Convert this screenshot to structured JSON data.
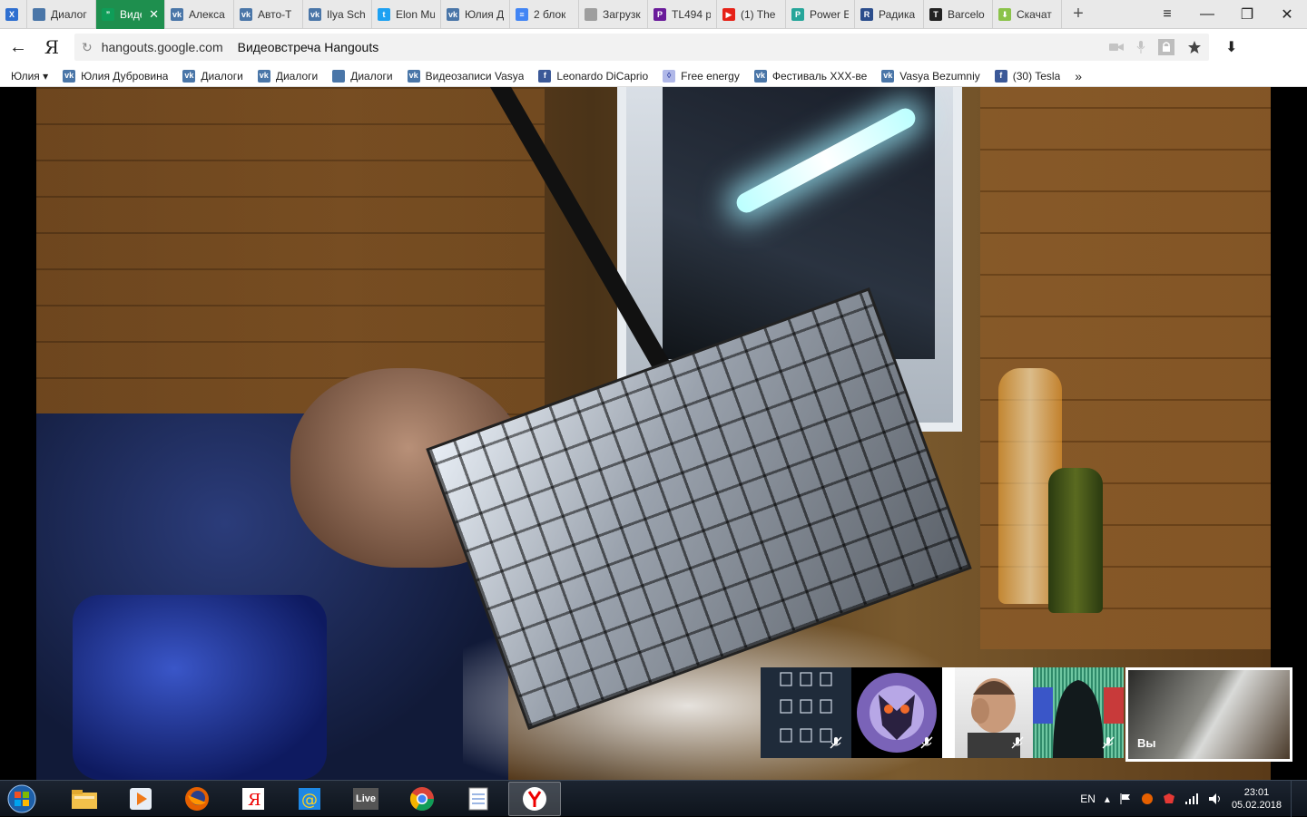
{
  "browser": {
    "tabs": [
      {
        "label": "",
        "icon": "yandex-x-icon",
        "color": "#2e6fd0",
        "glyph": "X",
        "width": 30
      },
      {
        "label": "Диалог",
        "icon": "chat-bubble-icon",
        "color": "#4a76a8",
        "glyph": "",
        "width": 76
      },
      {
        "label": "Виде",
        "icon": "hangouts-icon",
        "color": "#0f9d58",
        "glyph": "”",
        "width": 76,
        "active": true
      },
      {
        "label": "Алекса",
        "icon": "vk-icon",
        "color": "#4a76a8",
        "glyph": "vk",
        "width": 76
      },
      {
        "label": "Авто-Т",
        "icon": "vk-icon",
        "color": "#4a76a8",
        "glyph": "vk",
        "width": 76
      },
      {
        "label": "Ilya Sch",
        "icon": "vk-icon",
        "color": "#4a76a8",
        "glyph": "vk",
        "width": 76
      },
      {
        "label": "Elon Mu",
        "icon": "twitter-icon",
        "color": "#1da1f2",
        "glyph": "t",
        "width": 76
      },
      {
        "label": "Юлия Д",
        "icon": "vk-icon",
        "color": "#4a76a8",
        "glyph": "vk",
        "width": 76
      },
      {
        "label": "2 блок",
        "icon": "docs-icon",
        "color": "#4285f4",
        "glyph": "≡",
        "width": 76
      },
      {
        "label": "Загрузк",
        "icon": "page-icon",
        "color": "#9e9e9e",
        "glyph": "",
        "width": 76
      },
      {
        "label": "TL494 р",
        "icon": "pdf-icon",
        "color": "#6a1b9a",
        "glyph": "P",
        "width": 76
      },
      {
        "label": "(1) The",
        "icon": "youtube-icon",
        "color": "#e62117",
        "glyph": "▶",
        "width": 76
      },
      {
        "label": "Power E",
        "icon": "power-icon",
        "color": "#26a69a",
        "glyph": "P",
        "width": 76
      },
      {
        "label": "Радика",
        "icon": "radiokot-icon",
        "color": "#2b4d8c",
        "glyph": "R",
        "width": 76
      },
      {
        "label": "Barcelo",
        "icon": "t-logo-icon",
        "color": "#222222",
        "glyph": "T",
        "width": 76
      },
      {
        "label": "Скачат",
        "icon": "download-arrow-icon",
        "color": "#8bc34a",
        "glyph": "⬇",
        "width": 76
      }
    ],
    "new_tab": "+",
    "window": {
      "menu": "≡",
      "minimize": "—",
      "restore": "❐",
      "close": "✕"
    },
    "address": {
      "back": "←",
      "yandex": "Я",
      "reload": "↻",
      "domain": "hangouts.google.com",
      "title": "Видеовстреча Hangouts",
      "download": "⬇"
    },
    "bookmarks": [
      {
        "label": "Юлия ▾",
        "icon": "",
        "kind": "folder"
      },
      {
        "label": "Юлия Дубровина",
        "icon": "vk-icon",
        "kind": "vk"
      },
      {
        "label": "Диалоги",
        "icon": "vk-icon",
        "kind": "vk"
      },
      {
        "label": "Диалоги",
        "icon": "vk-icon",
        "kind": "vk"
      },
      {
        "label": "Диалоги",
        "icon": "chat-bubble-icon",
        "kind": "chat"
      },
      {
        "label": "Видеозаписи Vasya",
        "icon": "vk-icon",
        "kind": "vk"
      },
      {
        "label": "Leonardo DiCaprio",
        "icon": "facebook-icon",
        "kind": "fb"
      },
      {
        "label": "Free energy",
        "icon": "free-energy-icon",
        "kind": "fe"
      },
      {
        "label": "Фестиваль XXX-ве",
        "icon": "vk-icon",
        "kind": "vk"
      },
      {
        "label": "Vasya Bezumniy",
        "icon": "vk-icon",
        "kind": "vk"
      },
      {
        "label": "(30) Tesla",
        "icon": "facebook-icon",
        "kind": "fb"
      }
    ],
    "bookmarks_overflow": "»"
  },
  "hangout": {
    "self_label": "Вы",
    "participants": [
      {
        "name": "participant-cups",
        "muted": true,
        "width": 100
      },
      {
        "name": "participant-owl",
        "muted": true,
        "width": 100
      },
      {
        "name": "participant-man",
        "muted": true,
        "width": 86
      },
      {
        "name": "participant-hood",
        "muted": true,
        "width": 100
      }
    ]
  },
  "taskbar": {
    "apps": [
      {
        "name": "explorer",
        "icon": "folder-icon",
        "active": false
      },
      {
        "name": "media-player",
        "icon": "media-player-icon",
        "active": false
      },
      {
        "name": "firefox",
        "icon": "firefox-icon",
        "active": false
      },
      {
        "name": "yandex-app",
        "icon": "yandex-y-icon",
        "active": false
      },
      {
        "name": "mail-agent",
        "icon": "mail-at-icon",
        "active": false
      },
      {
        "name": "live",
        "icon": "live-icon",
        "active": false,
        "label": "Live"
      },
      {
        "name": "chrome",
        "icon": "chrome-icon",
        "active": false
      },
      {
        "name": "notepad",
        "icon": "notepad-icon",
        "active": false
      },
      {
        "name": "yandex-browser",
        "icon": "yandex-browser-icon",
        "active": true
      }
    ],
    "tray": {
      "language": "EN",
      "time": "23:01",
      "date": "05.02.2018"
    }
  }
}
